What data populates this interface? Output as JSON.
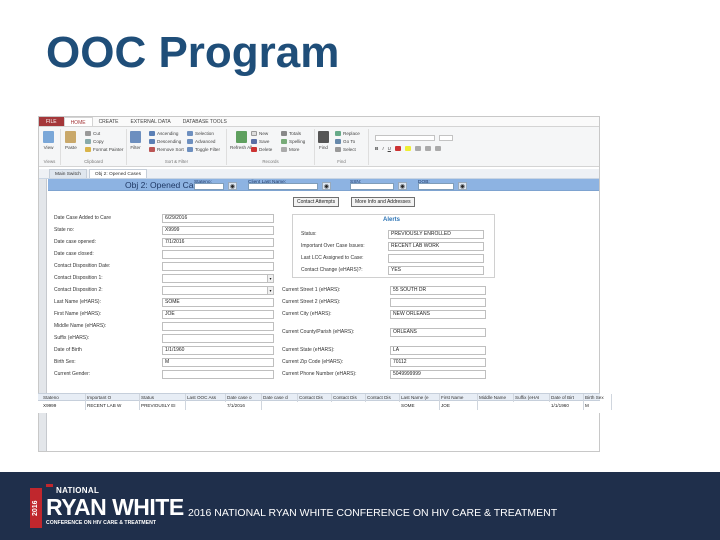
{
  "slide": {
    "title": "OOC Program"
  },
  "access": {
    "tabs": [
      {
        "label": "FILE"
      },
      {
        "label": "HOME"
      },
      {
        "label": "CREATE"
      },
      {
        "label": "EXTERNAL DATA"
      },
      {
        "label": "DATABASE TOOLS"
      }
    ],
    "ribbon": {
      "view": "View",
      "paste": "Paste",
      "cut": "Cut",
      "copy": "Copy",
      "format_painter": "Format Painter",
      "filter": "Filter",
      "ascending": "Ascending",
      "descending": "Descending",
      "remove_sort": "Remove Sort",
      "selection": "Selection",
      "advanced": "Advanced",
      "toggle_filter": "Toggle Filter",
      "refresh": "Refresh All",
      "new": "New",
      "save": "Save",
      "delete": "Delete",
      "totals": "Totals",
      "spelling": "Spelling",
      "more": "More",
      "find": "Find",
      "replace": "Replace",
      "goto": "Go To",
      "select": "Select",
      "groups": {
        "views": "Views",
        "clipboard": "Clipboard",
        "sort_filter": "Sort & Filter",
        "records": "Records",
        "find": "Find"
      }
    },
    "doc_tabs": [
      {
        "label": "Main Switch"
      },
      {
        "label": "Obj 2: Opened Cases"
      }
    ],
    "form": {
      "title": "Obj 2: Opened Cases",
      "header_search": [
        {
          "label": "Stateno:"
        },
        {
          "label": "Client Last Name:"
        },
        {
          "label": "SSN:"
        },
        {
          "label": "DOB:"
        }
      ],
      "buttons": {
        "contact_attempts": "Contact Attempts",
        "more_info": "More Info and Addresses"
      },
      "left_fields": [
        {
          "label": "Date Case Added to Care",
          "value": "6/29/2016"
        },
        {
          "label": "State no:",
          "value": "X9999"
        },
        {
          "label": "Date case opened:",
          "value": "7/1/2016"
        },
        {
          "label": "Date case closed:",
          "value": ""
        },
        {
          "label": "Contact Disposition Date:",
          "value": ""
        },
        {
          "label": "Contact Disposition 1:",
          "value": ""
        },
        {
          "label": "Contact Disposition 2:",
          "value": ""
        },
        {
          "label": "Last Name (eHARS):",
          "value": "SOME"
        },
        {
          "label": "First Name (eHARS):",
          "value": "JOE"
        },
        {
          "label": "Middle Name (eHARS):",
          "value": ""
        },
        {
          "label": "Suffix (eHARS):",
          "value": ""
        },
        {
          "label": "Date of Birth",
          "value": "1/1/1960"
        },
        {
          "label": "Birth Sex:",
          "value": "M"
        },
        {
          "label": "Current Gender:",
          "value": ""
        }
      ],
      "alerts": {
        "title": "Alerts",
        "rows": [
          {
            "label": "Status:",
            "value": "PREVIOUSLY ENROLLED"
          },
          {
            "label": "Important Over Case Issues:",
            "value": "RECENT LAB WORK"
          },
          {
            "label": "Last LCC Assigned to Case:",
            "value": ""
          },
          {
            "label": "Contact Change (eHARS)?:",
            "value": "YES"
          }
        ]
      },
      "right_fields": [
        {
          "label": "Current Street 1 (eHARS):",
          "value": "55 SOUTH DR"
        },
        {
          "label": "Current Street 2 (eHARS):",
          "value": ""
        },
        {
          "label": "Current City (eHARS):",
          "value": "NEW ORLEANS"
        },
        {
          "label": "Current County/Parish (eHARS):",
          "value": "ORLEANS"
        },
        {
          "label": "Current State (eHARS):",
          "value": "LA"
        },
        {
          "label": "Current Zip Code (eHARS):",
          "value": "70112"
        },
        {
          "label": "Current Phone Number (eHARS):",
          "value": "5049999999"
        }
      ]
    },
    "datasheet": {
      "headers": [
        "Stateno",
        "Important O",
        "Status",
        "Last OOC Ass",
        "Date case o",
        "Date case cl",
        "Contact Dis",
        "Contact Dis",
        "Contact Dis",
        "Last Name (e",
        "First Name",
        "Middle Name",
        "Suffix (eHAI",
        "Date of Birt",
        "Birth Sex"
      ],
      "rows": [
        [
          "X9999",
          "RECENT LAB W",
          "PREVIOUSLY EI",
          "",
          "7/1/2016",
          "",
          "",
          "",
          "",
          "SOME",
          "JOE",
          "",
          "",
          "1/1/1960",
          "M"
        ]
      ]
    }
  },
  "footer": {
    "logo_year": "2016",
    "logo_national": "NATIONAL",
    "logo_name": "RYAN WHITE",
    "logo_sub": "CONFERENCE ON HIV CARE & TREATMENT",
    "text": "2016 NATIONAL RYAN WHITE CONFERENCE ON HIV CARE & TREATMENT"
  }
}
